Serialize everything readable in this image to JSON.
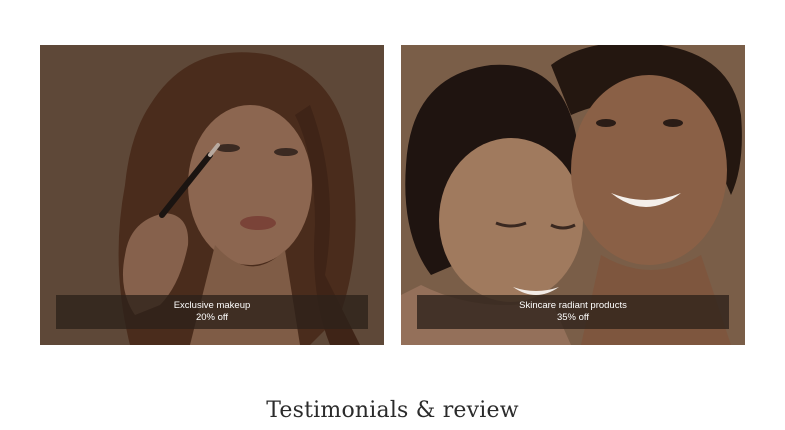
{
  "promos": [
    {
      "title": "Exclusive makeup",
      "offer": "20% off",
      "palette": {
        "background": "#5e4838",
        "skin": "#8c6650",
        "hair": "#4a2c1c"
      }
    },
    {
      "title": "Skincare radiant products",
      "offer": "35% off",
      "palette": {
        "background": "#7a5e48",
        "skin": "#9a7254",
        "hair": "#1f1410"
      }
    }
  ],
  "section": {
    "title": "Testimonials & review"
  }
}
